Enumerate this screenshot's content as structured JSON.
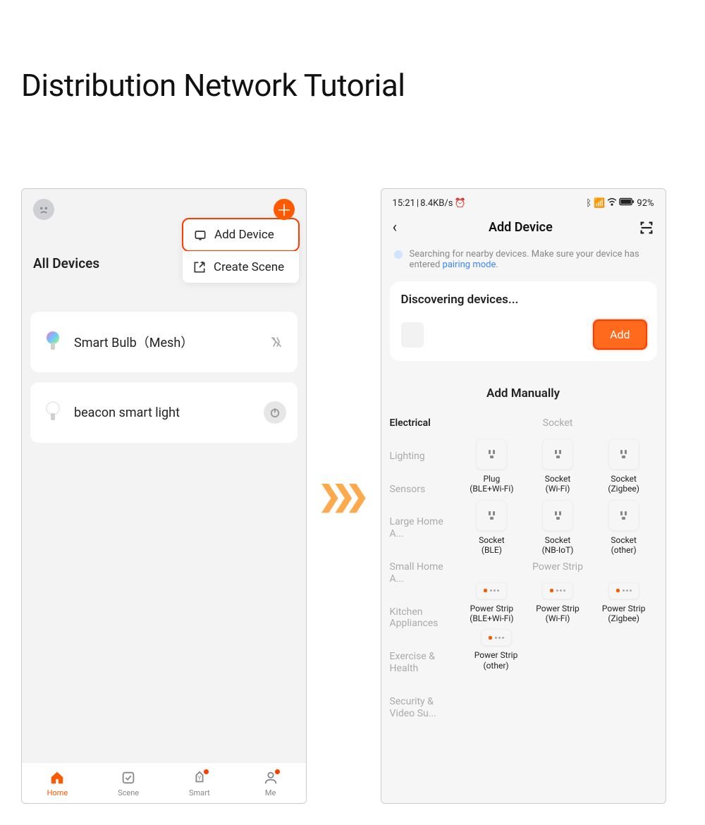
{
  "page_title": "Distribution Network Tutorial",
  "screen1": {
    "section_title": "All Devices",
    "dropdown": {
      "add_device": "Add Device",
      "create_scene": "Create Scene"
    },
    "devices": [
      {
        "name": "Smart Bulb（Mesh）",
        "status_icon": "disconnected"
      },
      {
        "name": "beacon smart light",
        "status_icon": "power"
      }
    ],
    "tabs": {
      "home": "Home",
      "scene": "Scene",
      "smart": "Smart",
      "me": "Me"
    }
  },
  "screen2": {
    "status": {
      "time": "15:21",
      "net": "8.4KB/s",
      "battery": "92%"
    },
    "nav_title": "Add Device",
    "info_prefix": "Searching for nearby devices. Make sure your device has entered ",
    "info_link": "pairing mode",
    "info_suffix": ".",
    "discovering_title": "Discovering devices...",
    "add_button": "Add",
    "manual_title": "Add Manually",
    "categories": [
      "Electrical",
      "Lighting",
      "Sensors",
      "Large Home A...",
      "Small Home A...",
      "Kitchen Appliances",
      "Exercise & Health",
      "Security & Video Su..."
    ],
    "sub_socket": "Socket",
    "sub_powerstrip": "Power Strip",
    "products_socket": [
      {
        "name": "Plug",
        "proto": "(BLE+Wi-Fi)"
      },
      {
        "name": "Socket",
        "proto": "(Wi-Fi)"
      },
      {
        "name": "Socket",
        "proto": "(Zigbee)"
      },
      {
        "name": "Socket",
        "proto": "(BLE)"
      },
      {
        "name": "Socket",
        "proto": "(NB-IoT)"
      },
      {
        "name": "Socket",
        "proto": "(other)"
      }
    ],
    "products_strip": [
      {
        "name": "Power Strip",
        "proto": "(BLE+Wi-Fi)"
      },
      {
        "name": "Power Strip",
        "proto": "(Wi-Fi)"
      },
      {
        "name": "Power Strip",
        "proto": "(Zigbee)"
      },
      {
        "name": "Power Strip",
        "proto": "(other)"
      }
    ]
  }
}
